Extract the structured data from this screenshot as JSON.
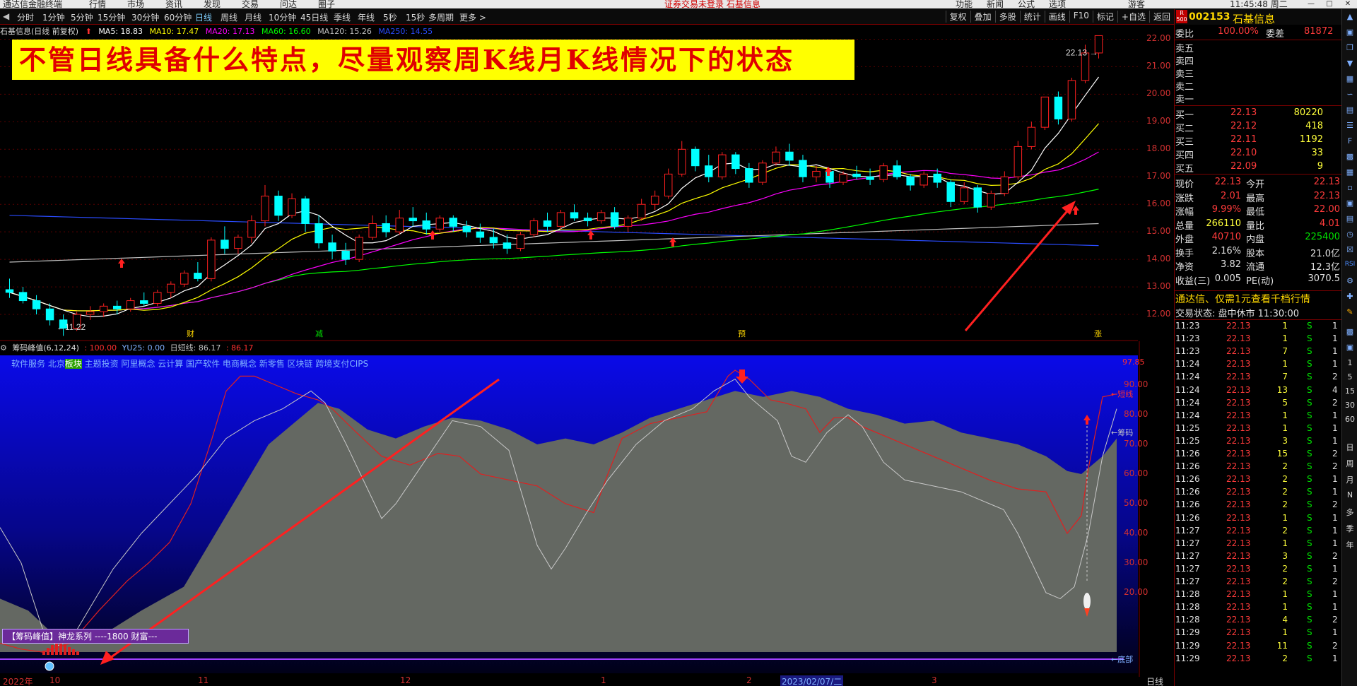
{
  "menubar": {
    "items": [
      "通达信金融终端",
      "行情",
      "市场",
      "资讯",
      "发现",
      "交易",
      "问达",
      "圈子"
    ],
    "warning": "证券交易未登录  石基信息",
    "right_items": [
      "功能",
      "新闻",
      "公式",
      "选项"
    ],
    "user": "游客",
    "clock": "11:45:48 周二"
  },
  "periods": [
    "分时",
    "1分钟",
    "5分钟",
    "15分钟",
    "30分钟",
    "60分钟",
    "日线",
    "周线",
    "月线",
    "10分钟",
    "45日线",
    "季线",
    "年线",
    "5秒",
    "15秒",
    "多周期",
    "更多 >"
  ],
  "active_period": "日线",
  "toolbar_right": [
    "复权",
    "叠加",
    "多股",
    "统计",
    "画线",
    "F10",
    "标记",
    "+自选",
    "返回"
  ],
  "chart_header": {
    "stock": "石基信息(日线 前复权)",
    "ma5": "MA5: 18.83",
    "ma10": "MA10: 17.47",
    "ma20": "MA20: 17.13",
    "ma60": "MA60: 16.60",
    "ma120": "MA120: 15.26",
    "ma250": "MA250: 14.55"
  },
  "colors": {
    "ma5": "#ffffff",
    "ma10": "#ffff00",
    "ma20": "#ff00ff",
    "ma60": "#00ff00",
    "ma120": "#c0c0c0",
    "ma250": "#2a4cff",
    "up": "#ff2020",
    "down": "#00ffff",
    "annotation_arrow": "#ff2020",
    "banner_bg": "#ffff00",
    "banner_text": "#e00000"
  },
  "banner": "不管日线具备什么特点，尽量观察周K线月K线情况下的状态",
  "main_chart": {
    "high_label": "22.13",
    "low_label": "←11.22",
    "y_ticks": [
      "22.00",
      "21.00",
      "20.00",
      "19.00",
      "18.00",
      "17.00",
      "16.00",
      "15.00",
      "14.00",
      "13.00",
      "12.00"
    ],
    "event_markers": [
      "财",
      "减",
      "预",
      "涨"
    ]
  },
  "chart_data": {
    "type": "candlestick",
    "ylim": [
      11.0,
      22.5
    ],
    "candles": [
      [
        12.9,
        13.3,
        12.6,
        12.8
      ],
      [
        12.8,
        13.0,
        12.4,
        12.5
      ],
      [
        12.5,
        12.7,
        12.0,
        12.2
      ],
      [
        12.2,
        12.4,
        11.6,
        11.8
      ],
      [
        11.8,
        12.0,
        11.22,
        11.5
      ],
      [
        11.5,
        12.1,
        11.4,
        12.0
      ],
      [
        12.0,
        12.3,
        11.8,
        12.1
      ],
      [
        12.1,
        12.4,
        11.9,
        12.3
      ],
      [
        12.3,
        12.5,
        12.0,
        12.2
      ],
      [
        12.2,
        12.6,
        12.1,
        12.5
      ],
      [
        12.5,
        12.8,
        12.3,
        12.4
      ],
      [
        12.4,
        12.9,
        12.3,
        12.8
      ],
      [
        12.8,
        13.2,
        12.6,
        13.1
      ],
      [
        13.1,
        13.6,
        13.0,
        13.5
      ],
      [
        13.5,
        13.9,
        13.2,
        13.3
      ],
      [
        13.3,
        14.8,
        13.2,
        14.7
      ],
      [
        14.7,
        15.2,
        14.2,
        14.4
      ],
      [
        14.4,
        14.9,
        14.2,
        14.8
      ],
      [
        14.8,
        15.6,
        14.6,
        15.4
      ],
      [
        15.4,
        16.7,
        15.2,
        16.3
      ],
      [
        16.3,
        16.5,
        15.4,
        15.6
      ],
      [
        15.6,
        16.4,
        15.5,
        16.2
      ],
      [
        16.2,
        16.3,
        15.0,
        15.3
      ],
      [
        15.3,
        15.6,
        14.4,
        14.6
      ],
      [
        14.6,
        14.9,
        14.0,
        14.3
      ],
      [
        14.3,
        14.6,
        13.8,
        14.0
      ],
      [
        14.0,
        14.9,
        13.9,
        14.8
      ],
      [
        14.8,
        15.6,
        14.7,
        15.3
      ],
      [
        15.3,
        15.6,
        14.8,
        15.0
      ],
      [
        15.0,
        15.8,
        14.9,
        15.5
      ],
      [
        15.5,
        15.9,
        15.2,
        15.4
      ],
      [
        15.4,
        15.7,
        14.9,
        15.1
      ],
      [
        15.1,
        15.6,
        15.0,
        15.5
      ],
      [
        15.5,
        15.6,
        15.0,
        15.2
      ],
      [
        15.2,
        15.4,
        14.8,
        15.0
      ],
      [
        15.0,
        15.3,
        14.6,
        14.8
      ],
      [
        14.8,
        15.1,
        14.4,
        14.6
      ],
      [
        14.6,
        14.9,
        14.2,
        14.4
      ],
      [
        14.4,
        15.0,
        14.3,
        14.9
      ],
      [
        14.9,
        15.5,
        14.8,
        15.4
      ],
      [
        15.4,
        15.7,
        15.0,
        15.2
      ],
      [
        15.2,
        15.8,
        15.1,
        15.7
      ],
      [
        15.7,
        16.0,
        15.4,
        15.5
      ],
      [
        15.5,
        15.7,
        15.2,
        15.4
      ],
      [
        15.4,
        15.8,
        15.3,
        15.7
      ],
      [
        15.7,
        15.9,
        15.1,
        15.2
      ],
      [
        15.2,
        15.6,
        15.0,
        15.5
      ],
      [
        15.5,
        16.2,
        15.4,
        16.0
      ],
      [
        16.0,
        16.5,
        15.8,
        16.3
      ],
      [
        16.3,
        17.3,
        16.2,
        17.1
      ],
      [
        17.1,
        18.3,
        17.0,
        18.0
      ],
      [
        18.0,
        18.1,
        17.2,
        17.4
      ],
      [
        17.4,
        17.8,
        16.8,
        17.0
      ],
      [
        17.0,
        17.9,
        16.9,
        17.8
      ],
      [
        17.8,
        17.9,
        17.1,
        17.3
      ],
      [
        17.3,
        17.5,
        16.6,
        16.8
      ],
      [
        16.8,
        17.6,
        16.7,
        17.5
      ],
      [
        17.5,
        18.1,
        17.4,
        17.9
      ],
      [
        17.9,
        18.2,
        17.4,
        17.6
      ],
      [
        17.6,
        17.8,
        16.8,
        17.0
      ],
      [
        17.0,
        17.4,
        16.8,
        17.2
      ],
      [
        17.2,
        17.3,
        16.6,
        16.8
      ],
      [
        16.8,
        17.2,
        16.7,
        17.1
      ],
      [
        17.1,
        17.4,
        16.9,
        17.0
      ],
      [
        17.0,
        17.3,
        16.7,
        16.9
      ],
      [
        16.9,
        17.5,
        16.8,
        17.4
      ],
      [
        17.4,
        17.6,
        16.9,
        17.0
      ],
      [
        17.0,
        17.1,
        16.5,
        16.7
      ],
      [
        16.7,
        17.2,
        16.6,
        17.1
      ],
      [
        17.1,
        17.3,
        16.6,
        16.8
      ],
      [
        16.8,
        16.9,
        15.9,
        16.1
      ],
      [
        16.1,
        16.8,
        16.0,
        16.6
      ],
      [
        16.6,
        16.7,
        15.7,
        15.9
      ],
      [
        15.9,
        16.5,
        15.8,
        16.4
      ],
      [
        16.4,
        17.2,
        16.3,
        17.0
      ],
      [
        17.0,
        18.3,
        16.9,
        18.1
      ],
      [
        18.1,
        19.0,
        18.0,
        18.8
      ],
      [
        18.8,
        19.9,
        18.7,
        19.9
      ],
      [
        19.9,
        20.1,
        18.9,
        19.1
      ],
      [
        19.1,
        20.6,
        19.0,
        20.5
      ],
      [
        20.5,
        21.8,
        20.4,
        21.5
      ],
      [
        21.5,
        22.13,
        21.3,
        22.13
      ]
    ],
    "indicator": {
      "name": "筹码峰值(6,12,24)",
      "ylim": [
        0,
        100
      ],
      "y_ticks": [
        "97.85",
        "90.00",
        "80.00",
        "70.00",
        "60.00",
        "50.00",
        "40.00",
        "30.00",
        "20.00"
      ]
    }
  },
  "indicator_header": {
    "name": "筹码峰值(6,12,24)",
    "v1": ": 100.00",
    "v2": "YU25: 0.00",
    "v3": "日短线: 86.17",
    "v4": ": 86.17"
  },
  "concepts": {
    "before": "软件服务 北京",
    "highlight": "板块",
    "after": " 主题投资 阿里概念 云计算 国产软件 电商概念 新零售 区块链 跨境支付CIPS"
  },
  "indicator_labels": {
    "top": "97.85",
    "short": "←短线",
    "chip": "←筹码",
    "bottom": "←底部"
  },
  "legend_text": "【筹码峰值】神龙系列 ----1800 财富---",
  "date_axis": {
    "labels": [
      "2022年",
      "10",
      "11",
      "12",
      "1",
      "2",
      "2023/02/07/二",
      "3"
    ],
    "right": "日线"
  },
  "quote": {
    "code": "002153",
    "name": "石基信息",
    "badge": "R 500",
    "weibi_label": "委比",
    "weibi": "100.00%",
    "weicha_label": "委差",
    "weicha": "81872",
    "sells": [
      {
        "label": "卖五",
        "price": "",
        "vol": ""
      },
      {
        "label": "卖四",
        "price": "",
        "vol": ""
      },
      {
        "label": "卖三",
        "price": "",
        "vol": ""
      },
      {
        "label": "卖二",
        "price": "",
        "vol": ""
      },
      {
        "label": "卖一",
        "price": "",
        "vol": ""
      }
    ],
    "buys": [
      {
        "label": "买一",
        "price": "22.13",
        "vol": "80220"
      },
      {
        "label": "买二",
        "price": "22.12",
        "vol": "418"
      },
      {
        "label": "买三",
        "price": "22.11",
        "vol": "1192"
      },
      {
        "label": "买四",
        "price": "22.10",
        "vol": "33"
      },
      {
        "label": "买五",
        "price": "22.09",
        "vol": "9"
      }
    ],
    "stats": [
      [
        "现价",
        "22.13",
        "今开",
        "22.13"
      ],
      [
        "涨跌",
        "2.01",
        "最高",
        "22.13"
      ],
      [
        "涨幅",
        "9.99%",
        "最低",
        "22.00"
      ],
      [
        "总量",
        "266110",
        "量比",
        "4.01"
      ],
      [
        "外盘",
        "40710",
        "内盘",
        "225400"
      ],
      [
        "换手",
        "2.16%",
        "股本",
        "21.0亿"
      ],
      [
        "净资",
        "3.82",
        "流通",
        "12.3亿"
      ],
      [
        "收益(三)",
        "0.005",
        "PE(动)",
        "3070.5"
      ]
    ],
    "promo": "通达信、仅需1元查看千档行情",
    "trade_status": "交易状态: 盘中休市 11:30:00"
  },
  "ticks": [
    [
      "11:23",
      "22.13",
      "1",
      "S",
      "1"
    ],
    [
      "11:23",
      "22.13",
      "1",
      "S",
      "1"
    ],
    [
      "11:23",
      "22.13",
      "7",
      "S",
      "1"
    ],
    [
      "11:24",
      "22.13",
      "1",
      "S",
      "1"
    ],
    [
      "11:24",
      "22.13",
      "7",
      "S",
      "2"
    ],
    [
      "11:24",
      "22.13",
      "13",
      "S",
      "4"
    ],
    [
      "11:24",
      "22.13",
      "5",
      "S",
      "2"
    ],
    [
      "11:24",
      "22.13",
      "1",
      "S",
      "1"
    ],
    [
      "11:25",
      "22.13",
      "1",
      "S",
      "1"
    ],
    [
      "11:25",
      "22.13",
      "3",
      "S",
      "1"
    ],
    [
      "11:26",
      "22.13",
      "15",
      "S",
      "2"
    ],
    [
      "11:26",
      "22.13",
      "2",
      "S",
      "2"
    ],
    [
      "11:26",
      "22.13",
      "2",
      "S",
      "1"
    ],
    [
      "11:26",
      "22.13",
      "2",
      "S",
      "1"
    ],
    [
      "11:26",
      "22.13",
      "2",
      "S",
      "2"
    ],
    [
      "11:26",
      "22.13",
      "1",
      "S",
      "1"
    ],
    [
      "11:27",
      "22.13",
      "2",
      "S",
      "1"
    ],
    [
      "11:27",
      "22.13",
      "1",
      "S",
      "1"
    ],
    [
      "11:27",
      "22.13",
      "3",
      "S",
      "2"
    ],
    [
      "11:27",
      "22.13",
      "2",
      "S",
      "1"
    ],
    [
      "11:27",
      "22.13",
      "2",
      "S",
      "2"
    ],
    [
      "11:28",
      "22.13",
      "1",
      "S",
      "1"
    ],
    [
      "11:28",
      "22.13",
      "1",
      "S",
      "1"
    ],
    [
      "11:28",
      "22.13",
      "4",
      "S",
      "2"
    ],
    [
      "11:29",
      "22.13",
      "1",
      "S",
      "1"
    ],
    [
      "11:29",
      "22.13",
      "11",
      "S",
      "2"
    ],
    [
      "11:29",
      "22.13",
      "2",
      "S",
      "1"
    ]
  ],
  "right_strip_text": [
    "日",
    "周",
    "月",
    "N",
    "多",
    "季",
    "年"
  ]
}
